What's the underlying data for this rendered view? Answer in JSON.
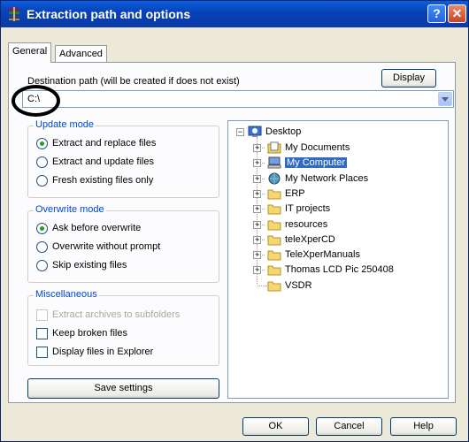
{
  "window": {
    "title": "Extraction path and options",
    "help_glyph": "?",
    "close_glyph": "✕"
  },
  "tabs": [
    {
      "label": "General"
    },
    {
      "label": "Advanced"
    }
  ],
  "destination": {
    "label": "Destination path (will be created if does not exist)",
    "value": "C:\\",
    "display_button": "Display"
  },
  "update_mode": {
    "title": "Update mode",
    "options": [
      "Extract and replace files",
      "Extract and update files",
      "Fresh existing files only"
    ],
    "selected": 0
  },
  "overwrite_mode": {
    "title": "Overwrite mode",
    "options": [
      "Ask before overwrite",
      "Overwrite without prompt",
      "Skip existing files"
    ],
    "selected": 0
  },
  "misc": {
    "title": "Miscellaneous",
    "options": [
      {
        "label": "Extract archives to subfolders",
        "checked": false,
        "disabled": true
      },
      {
        "label": "Keep broken files",
        "checked": false,
        "disabled": false
      },
      {
        "label": "Display files in Explorer",
        "checked": false,
        "disabled": false
      }
    ]
  },
  "save_button": "Save settings",
  "tree": {
    "root": "Desktop",
    "items": [
      {
        "label": "My Documents",
        "icon": "my-documents-icon"
      },
      {
        "label": "My Computer",
        "icon": "my-computer-icon",
        "selected": true
      },
      {
        "label": "My Network Places",
        "icon": "network-places-icon"
      },
      {
        "label": "ERP",
        "icon": "folder-icon"
      },
      {
        "label": "IT projects",
        "icon": "folder-icon"
      },
      {
        "label": "resources",
        "icon": "folder-icon"
      },
      {
        "label": "teleXperCD",
        "icon": "folder-icon"
      },
      {
        "label": "TeleXperManuals",
        "icon": "folder-icon"
      },
      {
        "label": "Thomas LCD Pic 250408",
        "icon": "folder-icon"
      },
      {
        "label": "VSDR",
        "icon": "folder-icon"
      }
    ]
  },
  "footer": {
    "ok": "OK",
    "cancel": "Cancel",
    "help": "Help"
  },
  "colors": {
    "titlebar": "#0842b8",
    "selection": "#316ac5",
    "group_title": "#0046d5"
  }
}
